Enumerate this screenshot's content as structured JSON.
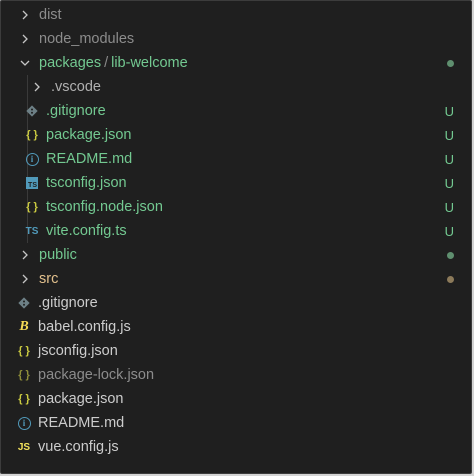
{
  "colors": {
    "untracked_green": "#73c991",
    "ignored_gray": "#8c8c8c",
    "default_text": "#cccccc",
    "json_yellow": "#cbcb41",
    "ts_blue": "#519aba",
    "babel_yellow": "#f5da55",
    "js_yellow": "#f1e05a",
    "git_icon": "#6d8086"
  },
  "explorer": {
    "items": [
      {
        "label": "dist",
        "icon": "chevron-right-icon"
      },
      {
        "label": "node_modules",
        "icon": "chevron-right-icon"
      },
      {
        "label_parts": [
          "packages",
          "/",
          "lib-welcome"
        ],
        "icon": "chevron-down-icon"
      },
      {
        "label": ".vscode",
        "icon": "chevron-right-icon"
      },
      {
        "label": ".gitignore",
        "icon": "git-icon",
        "badge": "U"
      },
      {
        "label": "package.json",
        "icon": "json-braces-icon",
        "icon_text": "{ }",
        "badge": "U"
      },
      {
        "label": "README.md",
        "icon": "info-icon",
        "icon_text": "i",
        "badge": "U"
      },
      {
        "label": "tsconfig.json",
        "icon": "tsconfig-icon",
        "icon_text": "TS",
        "badge": "U"
      },
      {
        "label": "tsconfig.node.json",
        "icon": "json-braces-icon",
        "icon_text": "{ }",
        "badge": "U"
      },
      {
        "label": "vite.config.ts",
        "icon": "typescript-icon",
        "icon_text": "TS",
        "badge": "U"
      },
      {
        "label": "public",
        "icon": "chevron-right-icon"
      },
      {
        "label": "src",
        "icon": "chevron-right-icon"
      },
      {
        "label": ".gitignore",
        "icon": "git-icon"
      },
      {
        "label": "babel.config.js",
        "icon": "babel-icon",
        "icon_text": "B"
      },
      {
        "label": "jsconfig.json",
        "icon": "json-braces-icon",
        "icon_text": "{ }"
      },
      {
        "label": "package-lock.json",
        "icon": "json-braces-icon",
        "icon_text": "{ }"
      },
      {
        "label": "package.json",
        "icon": "json-braces-icon",
        "icon_text": "{ }"
      },
      {
        "label": "README.md",
        "icon": "info-icon",
        "icon_text": "i"
      },
      {
        "label": "vue.config.js",
        "icon": "javascript-icon",
        "icon_text": "JS"
      }
    ]
  }
}
